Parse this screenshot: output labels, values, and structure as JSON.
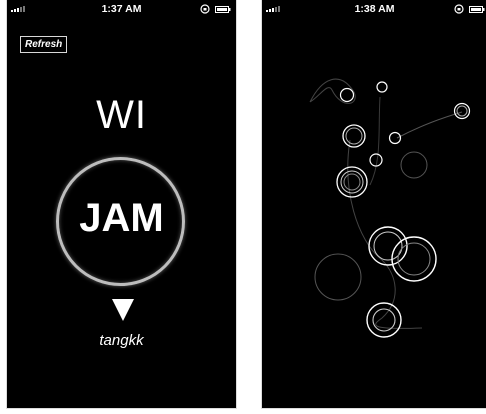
{
  "left_screen": {
    "status_bar": {
      "time": "1:37 AM"
    },
    "refresh_label": "Refresh",
    "top_word": "WI",
    "center_word": "JAM",
    "username": "tangkk"
  },
  "right_screen": {
    "status_bar": {
      "time": "1:38 AM"
    }
  },
  "colors": {
    "background": "#000000",
    "foreground": "#ffffff",
    "ring": "#bdbdbd",
    "faint": "#555555"
  },
  "icons": [
    "signal-bars-icon",
    "rotation-lock-icon",
    "battery-icon",
    "down-triangle-icon"
  ]
}
